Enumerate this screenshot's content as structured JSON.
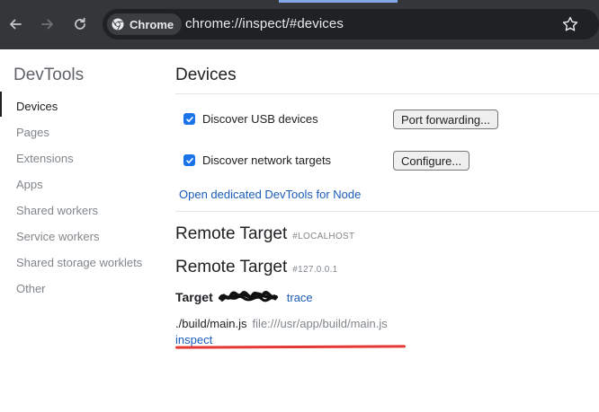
{
  "browser": {
    "chip_label": "Chrome",
    "url": "chrome://inspect/#devices",
    "icons": {
      "back": "back-arrow-icon",
      "forward": "forward-arrow-icon",
      "reload": "reload-icon",
      "site": "chrome-logo-icon",
      "bookmark": "star-icon"
    }
  },
  "sidebar": {
    "title": "DevTools",
    "items": [
      {
        "label": "Devices",
        "active": true
      },
      {
        "label": "Pages",
        "active": false
      },
      {
        "label": "Extensions",
        "active": false
      },
      {
        "label": "Apps",
        "active": false
      },
      {
        "label": "Shared workers",
        "active": false
      },
      {
        "label": "Service workers",
        "active": false
      },
      {
        "label": "Shared storage worklets",
        "active": false
      },
      {
        "label": "Other",
        "active": false
      }
    ]
  },
  "main": {
    "title": "Devices",
    "discover_usb": {
      "label": "Discover USB devices",
      "checked": true
    },
    "port_forwarding_button": "Port forwarding...",
    "discover_network": {
      "label": "Discover network targets",
      "checked": true
    },
    "configure_button": "Configure...",
    "node_link": "Open dedicated DevTools for Node",
    "remote_targets": [
      {
        "title": "Remote Target",
        "host": "#LOCALHOST"
      },
      {
        "title": "Remote Target",
        "host": "#127.0.0.1"
      }
    ],
    "target": {
      "label": "Target",
      "trace_link": "trace",
      "script_name": "./build/main.js",
      "script_url": "file:///usr/app/build/main.js",
      "inspect_link": "inspect"
    }
  },
  "colors": {
    "topbar": "#35363a",
    "omnibox": "#202124",
    "link": "#1a5cb8",
    "checkbox": "#1a73e8",
    "annotation_underline": "#e53935"
  }
}
